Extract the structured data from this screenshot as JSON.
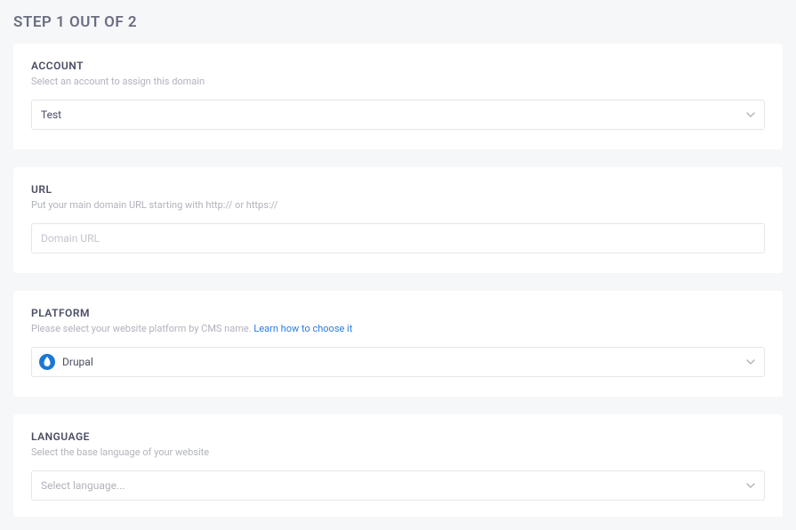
{
  "page_title": "STEP 1 OUT OF 2",
  "sections": {
    "account": {
      "label": "ACCOUNT",
      "hint": "Select an account to assign this domain",
      "selected": "Test"
    },
    "url": {
      "label": "URL",
      "hint": "Put your main domain URL starting with http:// or https://",
      "placeholder": "Domain URL",
      "value": ""
    },
    "platform": {
      "label": "PLATFORM",
      "hint_prefix": "Please select your website platform by CMS name.  ",
      "hint_link": "Learn how to choose it",
      "selected": "Drupal",
      "icon": "drupal-icon"
    },
    "language": {
      "label": "LANGUAGE",
      "hint": "Select the base language of your website",
      "placeholder": "Select language..."
    }
  }
}
